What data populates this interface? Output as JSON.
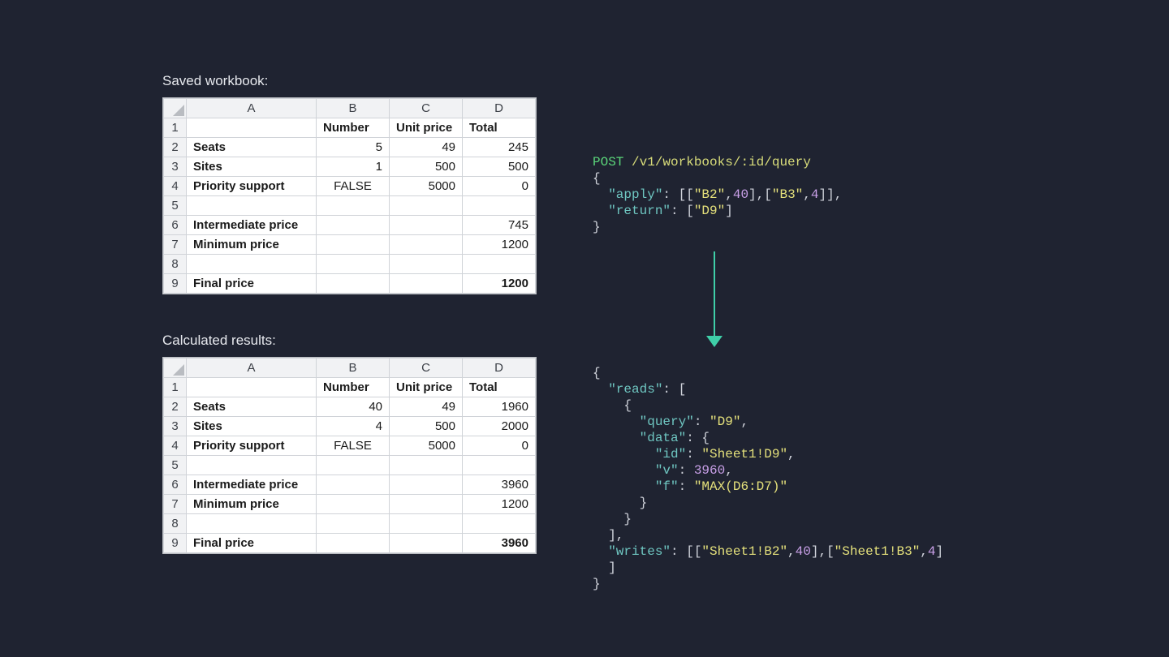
{
  "labels": {
    "saved": "Saved workbook:",
    "calculated": "Calculated results:"
  },
  "sheet_headers": {
    "A": "A",
    "B": "B",
    "C": "C",
    "D": "D"
  },
  "row_numbers": [
    "1",
    "2",
    "3",
    "4",
    "5",
    "6",
    "7",
    "8",
    "9"
  ],
  "header_row": {
    "number": "Number",
    "unit_price": "Unit price",
    "total": "Total"
  },
  "row_labels": {
    "seats": "Seats",
    "sites": "Sites",
    "priority": "Priority support",
    "intermediate": "Intermediate price",
    "minimum": "Minimum price",
    "final": "Final price"
  },
  "saved": {
    "seats": {
      "number": "5",
      "unit_price": "49",
      "total": "245"
    },
    "sites": {
      "number": "1",
      "unit_price": "500",
      "total": "500"
    },
    "priority": {
      "number": "FALSE",
      "unit_price": "5000",
      "total": "0"
    },
    "intermediate_total": "745",
    "minimum_total": "1200",
    "final_total": "1200"
  },
  "calc": {
    "seats": {
      "number": "40",
      "unit_price": "49",
      "total": "1960"
    },
    "sites": {
      "number": "4",
      "unit_price": "500",
      "total": "2000"
    },
    "priority": {
      "number": "FALSE",
      "unit_price": "5000",
      "total": "0"
    },
    "intermediate_total": "3960",
    "minimum_total": "1200",
    "final_total": "3960"
  },
  "request": {
    "method": "POST",
    "path": "/v1/workbooks/:id/query",
    "apply_key": "\"apply\"",
    "return_key": "\"return\"",
    "apply": [
      [
        "\"B2\"",
        "40"
      ],
      [
        "\"B3\"",
        "4"
      ]
    ],
    "return": [
      "\"D9\""
    ]
  },
  "response": {
    "reads_key": "\"reads\"",
    "writes_key": "\"writes\"",
    "query_key": "\"query\"",
    "data_key": "\"data\"",
    "id_key": "\"id\"",
    "v_key": "\"v\"",
    "f_key": "\"f\"",
    "query_val": "\"D9\"",
    "id_val": "\"Sheet1!D9\"",
    "v_val": "3960",
    "f_val": "\"MAX(D6:D7)\"",
    "writes": [
      [
        "\"Sheet1!B2\"",
        "40"
      ],
      [
        "\"Sheet1!B3\"",
        "4"
      ]
    ]
  }
}
